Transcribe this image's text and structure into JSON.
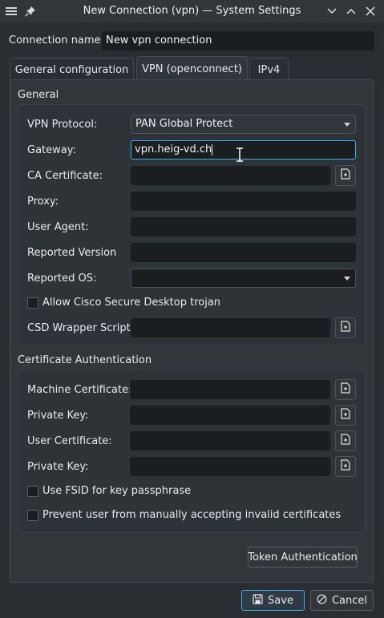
{
  "window": {
    "title": "New Connection (vpn) — System Settings",
    "menu_icon": "hamburger-menu-icon",
    "pin_icon": "pin-icon"
  },
  "connection_name": {
    "label": "Connection name:",
    "value": "New vpn connection"
  },
  "tabs": [
    {
      "label": "General configuration",
      "active": false
    },
    {
      "label": "VPN (openconnect)",
      "active": true
    },
    {
      "label": "IPv4",
      "active": false
    }
  ],
  "general": {
    "title": "General",
    "vpn_protocol": {
      "label": "VPN Protocol:",
      "value": "PAN Global Protect"
    },
    "gateway": {
      "label": "Gateway:",
      "value": "vpn.heig-vd.ch"
    },
    "ca_certificate": {
      "label": "CA Certificate:",
      "value": ""
    },
    "proxy": {
      "label": "Proxy:",
      "value": ""
    },
    "user_agent": {
      "label": "User Agent:",
      "value": ""
    },
    "reported_version": {
      "label": "Reported Version",
      "value": ""
    },
    "reported_os": {
      "label": "Reported OS:",
      "value": ""
    },
    "allow_csd": {
      "label": "Allow Cisco Secure Desktop trojan",
      "checked": false
    },
    "csd_wrapper": {
      "label": "CSD Wrapper Script:",
      "value": ""
    }
  },
  "cert_auth": {
    "title": "Certificate Authentication",
    "machine_certificate": {
      "label": "Machine Certificate:",
      "value": ""
    },
    "private_key_1": {
      "label": "Private Key:",
      "value": ""
    },
    "user_certificate": {
      "label": "User Certificate:",
      "value": ""
    },
    "private_key_2": {
      "label": "Private Key:",
      "value": ""
    },
    "use_fsid": {
      "label": "Use FSID for key passphrase",
      "checked": false
    },
    "prevent_invalid": {
      "label": "Prevent user from manually accepting invalid certificates",
      "checked": false
    }
  },
  "buttons": {
    "token_auth": "Token Authentication",
    "save": "Save",
    "cancel": "Cancel"
  },
  "colors": {
    "accent": "#3daee9",
    "window_bg": "#2a2e32",
    "field_bg": "#1b1e20"
  }
}
